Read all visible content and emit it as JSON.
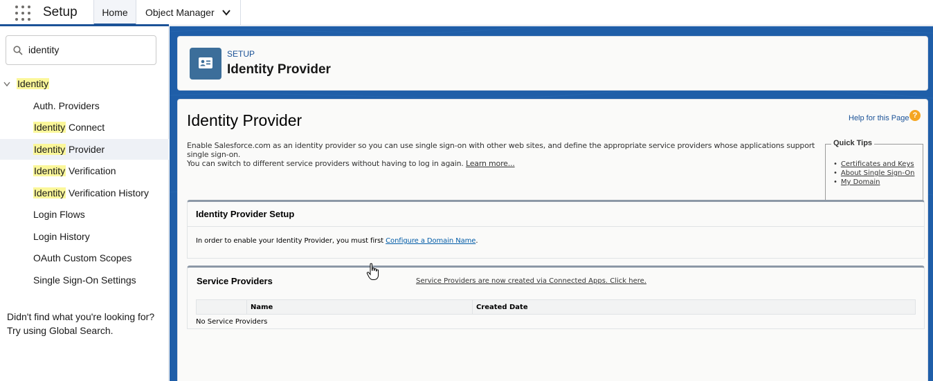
{
  "topbar": {
    "app_title": "Setup",
    "tabs": [
      {
        "label": "Home",
        "active": true
      },
      {
        "label": "Object Manager",
        "has_dropdown": true
      }
    ],
    "icons": [
      "app-launcher-icon",
      "chevron-down-icon"
    ]
  },
  "sidebar": {
    "search": {
      "value": "identity",
      "icon": "search-icon"
    },
    "parent": {
      "label": "Identity",
      "expanded": true
    },
    "items": [
      {
        "match": "",
        "rest": "Auth. Providers"
      },
      {
        "match": "Identity",
        "rest": " Connect"
      },
      {
        "match": "Identity",
        "rest": " Provider",
        "active": true
      },
      {
        "match": "Identity",
        "rest": " Verification"
      },
      {
        "match": "Identity",
        "rest": " Verification History"
      },
      {
        "match": "",
        "rest": "Login Flows"
      },
      {
        "match": "",
        "rest": "Login History"
      },
      {
        "match": "",
        "rest": "OAuth Custom Scopes"
      },
      {
        "match": "",
        "rest": "Single Sign-On Settings"
      }
    ],
    "not_found_line1": "Didn't find what you're looking for?",
    "not_found_line2": "Try using Global Search."
  },
  "header": {
    "breadcrumb": "SETUP",
    "title": "Identity Provider",
    "icon": "identity-card-icon"
  },
  "content": {
    "title": "Identity Provider",
    "help_link": "Help for this Page",
    "help_icon": "?",
    "description_line1": "Enable Salesforce.com as an identity provider so you can use single sign-on with other web sites, and define the appropriate service providers whose applications support single sign-on.",
    "description_line2": "You can switch to different service providers without having to log in again.",
    "learn_more": "Learn more...",
    "quick_tips": {
      "title": "Quick Tips",
      "items": [
        "Certificates and Keys",
        "About Single Sign-On",
        "My Domain"
      ]
    },
    "idp_setup": {
      "title": "Identity Provider Setup",
      "body_prefix": "In order to enable your Identity Provider, you must first ",
      "body_link": "Configure a Domain Name",
      "body_suffix": "."
    },
    "service_providers": {
      "title": "Service Providers",
      "notice_link": "Service Providers are now created via Connected Apps. Click here.",
      "columns": [
        "",
        "Name",
        "Created Date"
      ],
      "empty_text": "No Service Providers"
    }
  },
  "colors": {
    "brand_blue": "#1b5297",
    "main_bg": "#1f5ea8",
    "highlight": "#fbf79a",
    "header_icon_bg": "#3c6e9a",
    "help_icon": "#f5a623"
  }
}
